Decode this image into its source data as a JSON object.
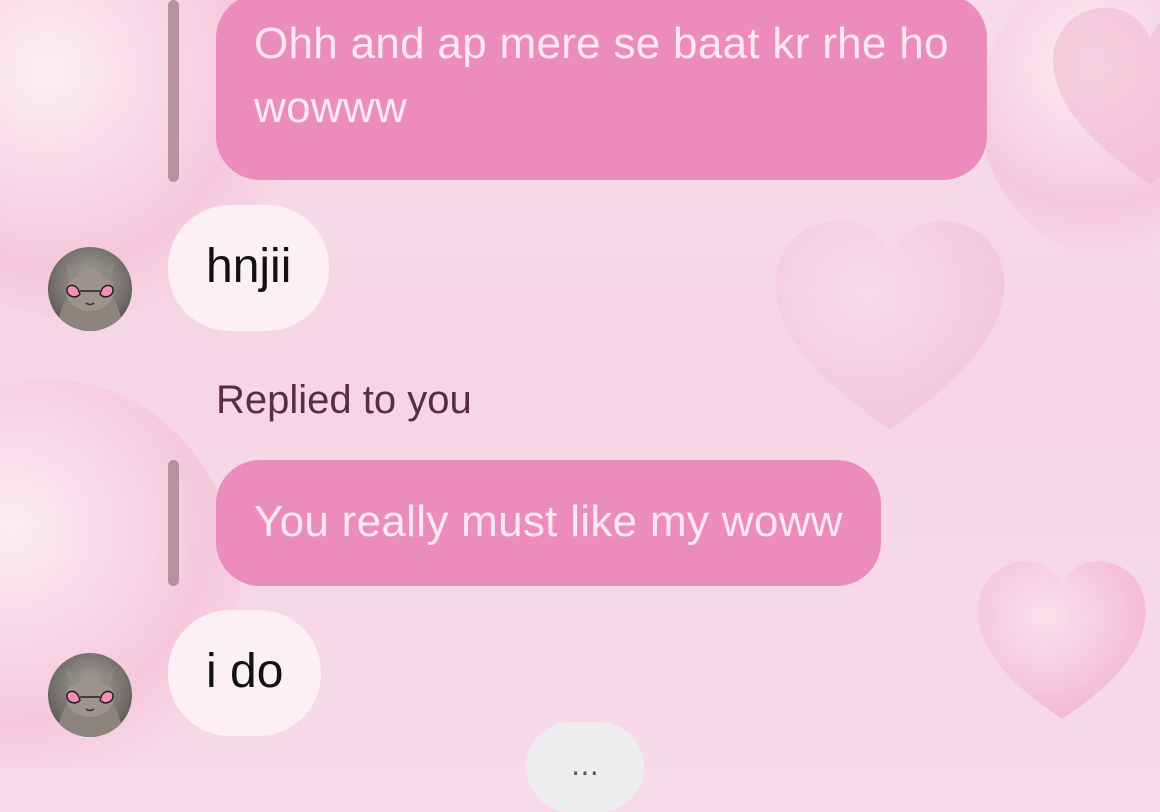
{
  "conversation": {
    "messages": [
      {
        "from": "me",
        "text": "Ohh and ap mere se baat kr rhe ho wowww"
      },
      {
        "from": "them",
        "text": "hnjii"
      },
      {
        "from": "meta",
        "text": "Replied to you"
      },
      {
        "from": "me",
        "text": "You really must like my woww"
      },
      {
        "from": "them",
        "text": "i do"
      }
    ]
  },
  "colors": {
    "background": "#f7d9e7",
    "my_bubble": "#ec8cbc",
    "my_text": "#fde8f2",
    "their_bubble": "#fdf0f4",
    "their_text": "#111111",
    "reply_bar": "#b8919f"
  },
  "icons": {
    "avatar": "cat-with-heart-sunglasses-avatar",
    "bottom_control": "more-dots-icon"
  }
}
